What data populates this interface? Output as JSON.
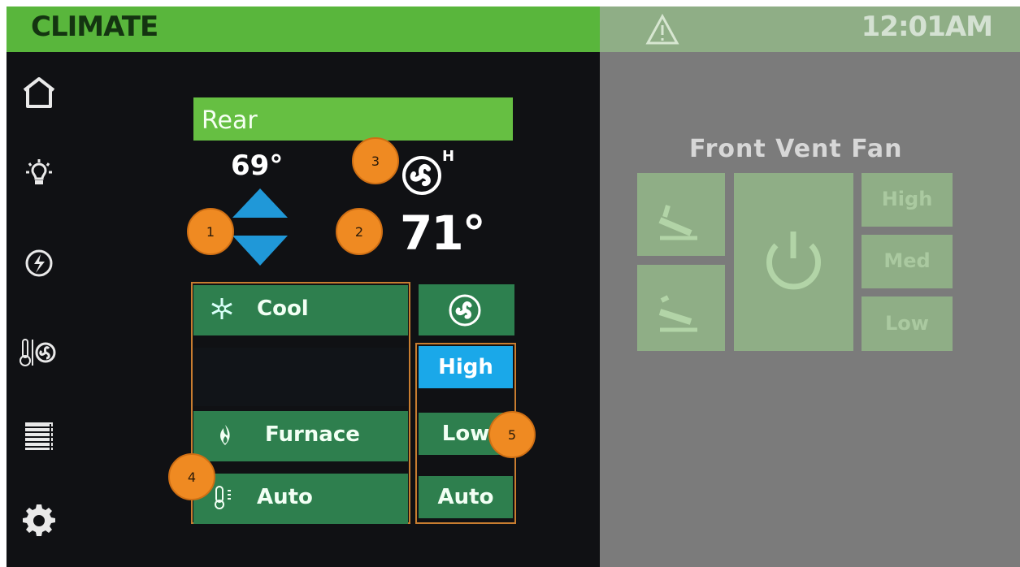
{
  "header": {
    "title": "CLIMATE",
    "clock": "12:01AM",
    "warning_icon": "warning-icon"
  },
  "sidebar": {
    "items": [
      {
        "name": "home-icon"
      },
      {
        "name": "light-icon"
      },
      {
        "name": "power-icon"
      },
      {
        "name": "climate-icon"
      },
      {
        "name": "shade-icon"
      },
      {
        "name": "settings-icon"
      }
    ]
  },
  "rear": {
    "zone": "Rear",
    "set_temp": "69°",
    "current_temp": "71°",
    "fan_level": "H"
  },
  "modes": {
    "cool": "Cool",
    "furnace": "Furnace",
    "auto": "Auto"
  },
  "fan": {
    "options": [
      "High",
      "Low",
      "Auto"
    ],
    "active": "High"
  },
  "right_panel": {
    "title": "Front Vent Fan",
    "speeds": [
      "High",
      "Med",
      "Low"
    ]
  },
  "badges": [
    "1",
    "2",
    "3",
    "4",
    "5"
  ],
  "colors": {
    "accent_green": "#59b63c",
    "rear_bar": "#66bf42",
    "button_green": "#2e7f4e",
    "active_blue": "#1aa8e9",
    "badge_orange": "#ef8a22",
    "overlay_gray": "#7b7b7b"
  }
}
